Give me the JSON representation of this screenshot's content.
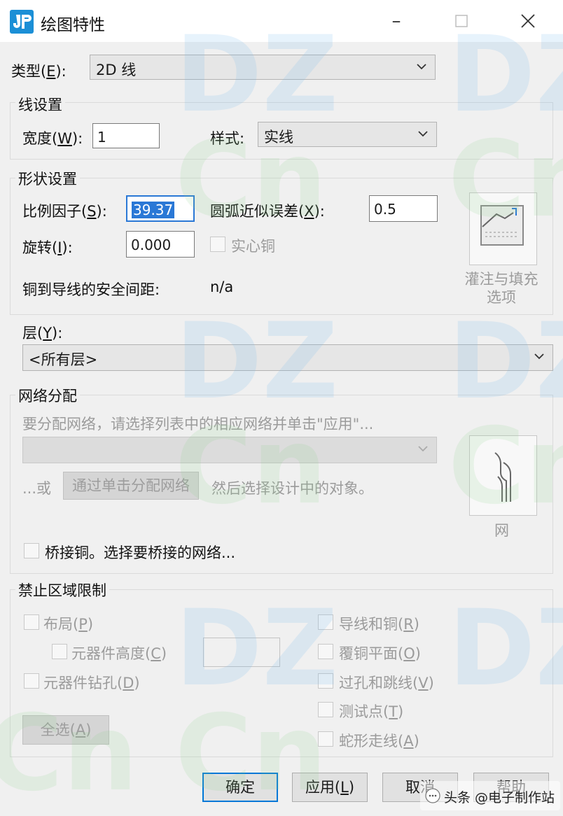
{
  "window": {
    "title": "绘图特性",
    "minimize_icon": "minimize-icon",
    "maximize_icon": "maximize-icon",
    "close_icon": "close-icon"
  },
  "type_row": {
    "label": "类型(",
    "key": "E",
    "label_end": "):",
    "value": "2D 线"
  },
  "line_settings": {
    "title": "线设置",
    "width_label": "宽度(",
    "width_key": "W",
    "width_label_end": "):",
    "width_value": "1",
    "style_label": "样式:",
    "style_value": "实线"
  },
  "shape_settings": {
    "title": "形状设置",
    "scale_label": "比例因子(",
    "scale_key": "S",
    "scale_label_end": "):",
    "scale_value": "39.37",
    "arc_label": "圆弧近似误差(",
    "arc_key": "X",
    "arc_label_end": "):",
    "arc_value": "0.5",
    "rotation_label": "旋转(",
    "rotation_key": "I",
    "rotation_label_end": "):",
    "rotation_value": "0.000",
    "solid_copper_label": "实心铜",
    "clearance_label": "铜到导线的安全间距:",
    "clearance_value": "n/a",
    "pour_fill_line1": "灌注与填充",
    "pour_fill_line2": "选项"
  },
  "layer": {
    "label": "层(",
    "key": "Y",
    "label_end": "):",
    "value": "<所有层>"
  },
  "net_assignment": {
    "title": "网络分配",
    "hint": "要分配网络，请选择列表中的相应网络并单击\"应用\"...",
    "or_text": "...或",
    "assign_button": "通过单击分配网络",
    "then_text": "然后选择设计中的对象。",
    "net_button_label": "网",
    "bridge_label": "桥接铜。选择要桥接的网络..."
  },
  "keepout": {
    "title": "禁止区域限制",
    "left_items": [
      {
        "label": "布局(",
        "key": "P",
        "end": ")"
      },
      {
        "label": "元器件高度(",
        "key": "C",
        "end": ")"
      },
      {
        "label": "元器件钻孔(",
        "key": "D",
        "end": ")"
      }
    ],
    "right_items": [
      {
        "label": "导线和铜(",
        "key": "R",
        "end": ")"
      },
      {
        "label": "覆铜平面(",
        "key": "O",
        "end": ")"
      },
      {
        "label": "过孔和跳线(",
        "key": "V",
        "end": ")"
      },
      {
        "label": "测试点(",
        "key": "T",
        "end": ")"
      },
      {
        "label": "蛇形走线(",
        "key": "A",
        "end": ")"
      }
    ],
    "select_all_label": "全选(",
    "select_all_key": "A",
    "select_all_end": ")"
  },
  "footer": {
    "ok": "确定",
    "apply_label": "应用(",
    "apply_key": "L",
    "apply_end": ")",
    "cancel": "取消",
    "help": "帮助"
  },
  "overlay": {
    "attribution": "头条 @电子制作站",
    "watermark": "DZCn"
  },
  "colors": {
    "accent": "#2a78d6",
    "icon_blue": "#1b8fd6",
    "dialog_bg": "#f0f0f0"
  }
}
